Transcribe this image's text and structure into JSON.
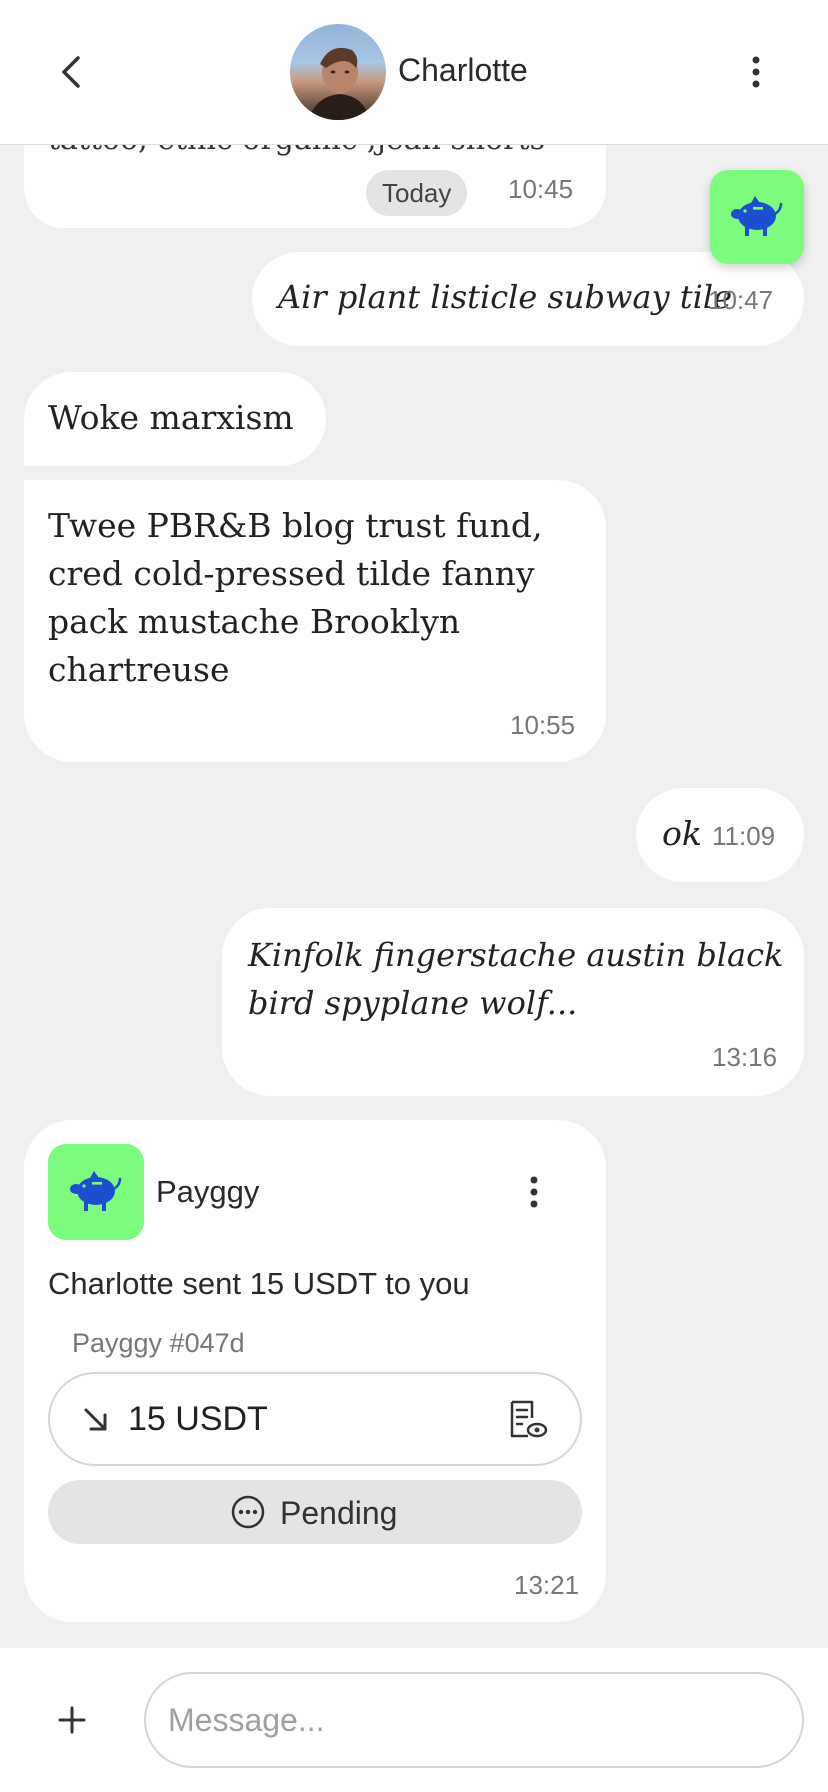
{
  "header": {
    "title": "Charlotte"
  },
  "messages": {
    "m1": {
      "partial_text": "tattoo, ethic organic ,jean shorts",
      "badge": "Today",
      "time": "10:45"
    },
    "m2": {
      "text": "Air plant listicle subway tile",
      "time": "10:47"
    },
    "m3": {
      "text": "Woke marxism"
    },
    "m4": {
      "line1": "Twee PBR&B blog trust fund,",
      "line2": "cred cold-pressed tilde fanny",
      "line3": "pack mustache Brooklyn",
      "line4": "chartreuse",
      "time": "10:55"
    },
    "m5": {
      "text": "ok",
      "time": "11:09"
    },
    "m6": {
      "line1": "Kinfolk fingerstache austin black",
      "line2": "bird spyplane wolf...",
      "time": "13:16"
    }
  },
  "payment_card": {
    "app_name": "Payggy",
    "description": "Charlotte sent 15 USDT to you",
    "reference": "Payggy #047d",
    "amount": "15 USDT",
    "status": "Pending",
    "time": "13:21"
  },
  "composer": {
    "placeholder": "Message..."
  },
  "colors": {
    "accent_green": "#7cfc7c",
    "pig_blue": "#1d4fd0"
  },
  "icons": [
    "back-arrow-icon",
    "more-vertical-icon",
    "piggy-bank-icon",
    "arrow-down-right-icon",
    "receipt-view-icon",
    "dots-circle-icon",
    "plus-icon"
  ]
}
